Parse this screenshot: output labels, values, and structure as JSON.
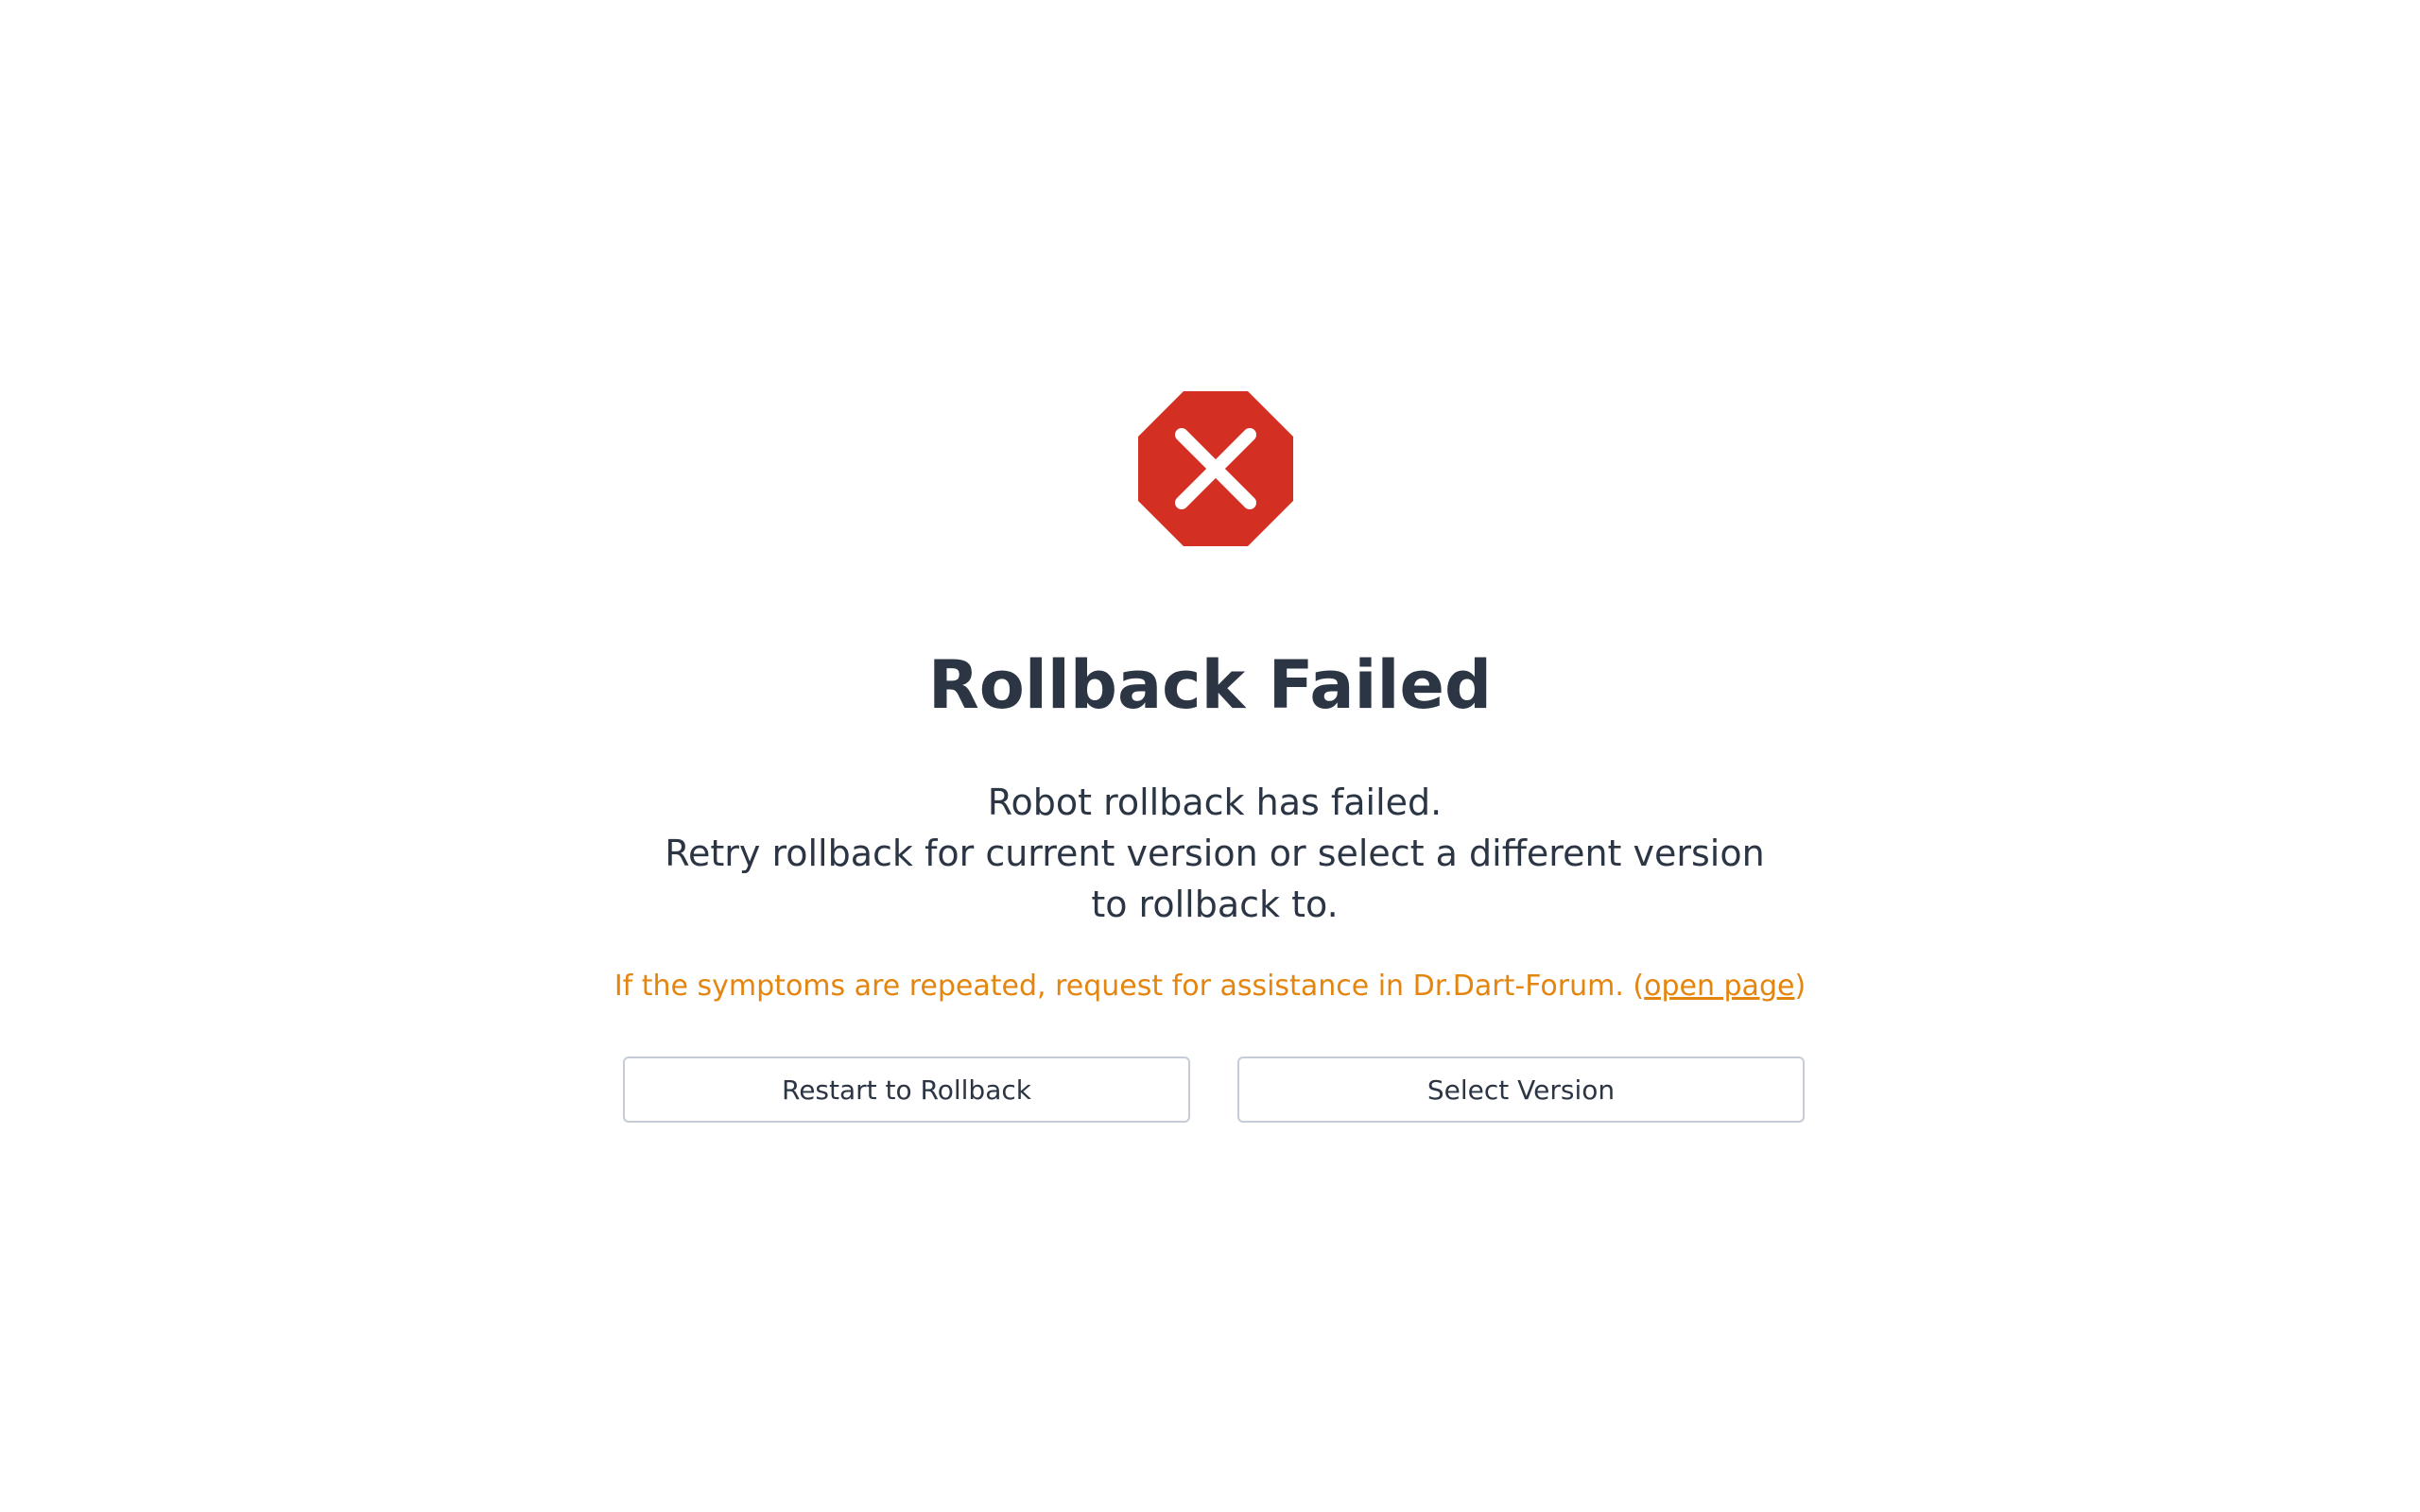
{
  "dialog": {
    "icon": "error-octagon-icon",
    "icon_color": "#d32f23",
    "title": "Rollback Failed",
    "message_lines": [
      "Robot rollback has failed.",
      "Retry rollback for current version or select a different version",
      "to rollback to."
    ],
    "notice": {
      "text": "If the symptoms are repeated, request for assistance in Dr.Dart-Forum. (",
      "link_text": "open page",
      "suffix": ")",
      "color": "#e3850f"
    },
    "buttons": {
      "restart_label": "Restart to Rollback",
      "select_label": "Select Version"
    }
  }
}
